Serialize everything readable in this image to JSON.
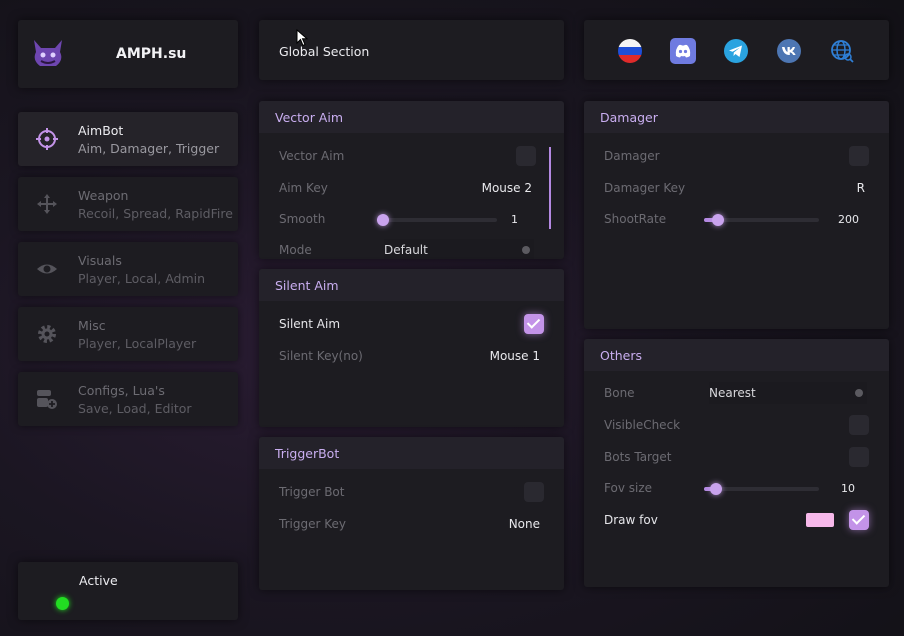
{
  "app": {
    "title": "AMPH.su"
  },
  "header": {
    "section_label": "Global Section"
  },
  "sidebar": {
    "items": [
      {
        "title": "AimBot",
        "subtitle": "Aim, Damager, Trigger",
        "icon": "crosshair-icon",
        "active": true
      },
      {
        "title": "Weapon",
        "subtitle": "Recoil, Spread, RapidFire",
        "icon": "move-arrows-icon",
        "active": false
      },
      {
        "title": "Visuals",
        "subtitle": "Player, Local, Admin",
        "icon": "eye-icon",
        "active": false
      },
      {
        "title": "Misc",
        "subtitle": "Player, LocalPlayer",
        "icon": "gear-icon",
        "active": false
      },
      {
        "title": "Configs, Lua's",
        "subtitle": "Save, Load, Editor",
        "icon": "config-plus-icon",
        "active": false
      }
    ],
    "status": {
      "label": "Active",
      "color": "#22dd22"
    }
  },
  "socials": [
    {
      "icon": "russia-flag-icon"
    },
    {
      "icon": "discord-icon"
    },
    {
      "icon": "telegram-icon"
    },
    {
      "icon": "vk-icon"
    },
    {
      "icon": "globe-icon"
    }
  ],
  "vector_aim": {
    "title": "Vector Aim",
    "vector_aim_label": "Vector Aim",
    "vector_aim_checked": false,
    "aim_key_label": "Aim Key",
    "aim_key_value": "Mouse 2",
    "smooth_label": "Smooth",
    "smooth_value": "1",
    "smooth_fraction": 0.0,
    "mode_label": "Mode",
    "mode_value": "Default"
  },
  "silent_aim": {
    "title": "Silent Aim",
    "silent_aim_label": "Silent Aim",
    "silent_aim_checked": true,
    "silent_key_label": "Silent Key(no)",
    "silent_key_value": "Mouse 1"
  },
  "triggerbot": {
    "title": "TriggerBot",
    "trigger_bot_label": "Trigger Bot",
    "trigger_bot_checked": false,
    "trigger_key_label": "Trigger Key",
    "trigger_key_value": "None"
  },
  "damager": {
    "title": "Damager",
    "damager_label": "Damager",
    "damager_checked": false,
    "damager_key_label": "Damager Key",
    "damager_key_value": "R",
    "shootrate_label": "ShootRate",
    "shootrate_value": "200",
    "shootrate_fraction": 0.08
  },
  "others": {
    "title": "Others",
    "bone_label": "Bone",
    "bone_value": "Nearest",
    "visible_check_label": "VisibleCheck",
    "visible_check_checked": false,
    "bots_target_label": "Bots Target",
    "bots_target_checked": false,
    "fov_size_label": "Fov size",
    "fov_size_value": "10",
    "fov_size_fraction": 0.06,
    "draw_fov_label": "Draw fov",
    "draw_fov_checked": true,
    "draw_fov_color": "#f7b8ea"
  },
  "colors": {
    "accent": "#c393e8",
    "panel": "#1d1c21",
    "header": "#24222a"
  }
}
